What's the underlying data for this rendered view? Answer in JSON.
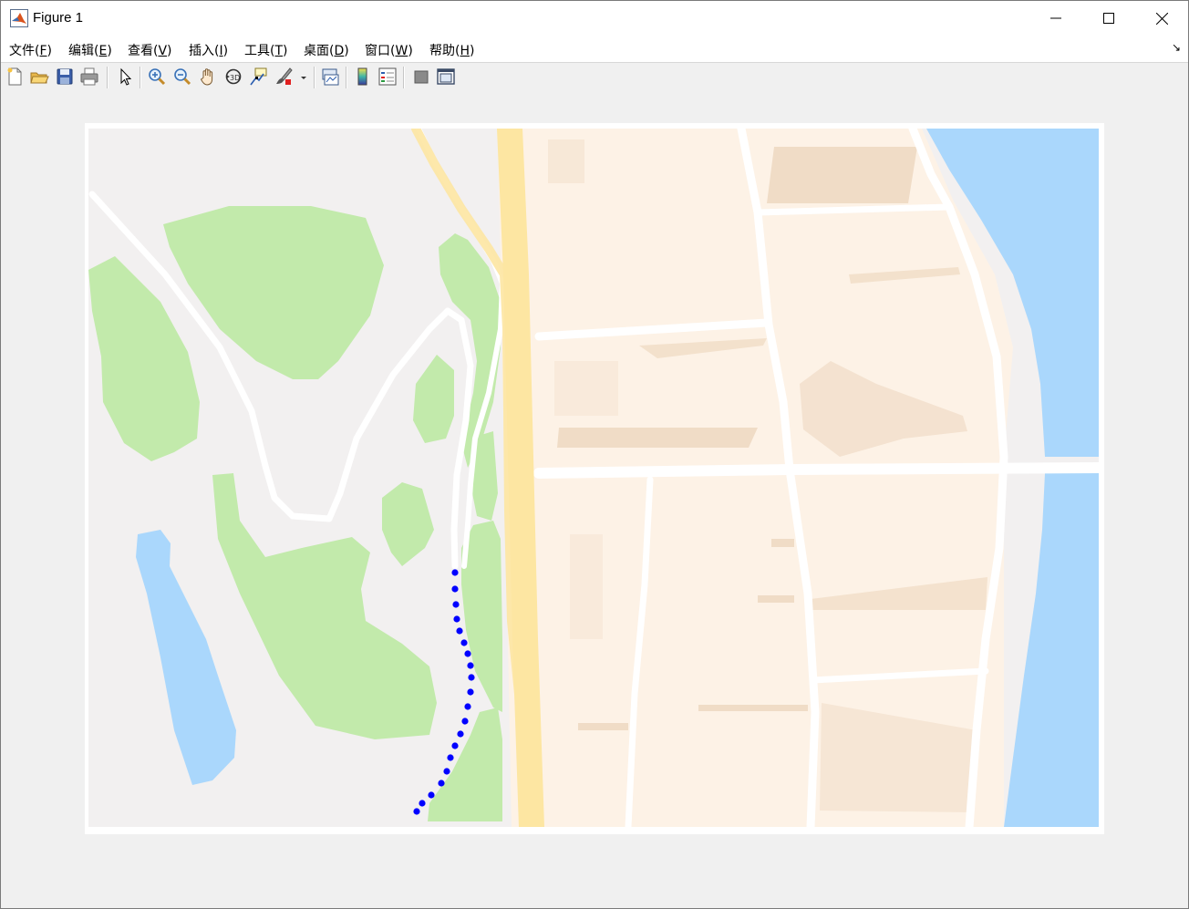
{
  "window": {
    "title": "Figure 1",
    "controls": {
      "minimize": "minimize-icon",
      "maximize": "maximize-icon",
      "close": "close-icon"
    }
  },
  "menubar": {
    "items": [
      {
        "label": "文件(",
        "key": "F",
        "end": ")"
      },
      {
        "label": "编辑(",
        "key": "E",
        "end": ")"
      },
      {
        "label": "查看(",
        "key": "V",
        "end": ")"
      },
      {
        "label": "插入(",
        "key": "I",
        "end": ")"
      },
      {
        "label": "工具(",
        "key": "T",
        "end": ")"
      },
      {
        "label": "桌面(",
        "key": "D",
        "end": ")"
      },
      {
        "label": "窗口(",
        "key": "W",
        "end": ")"
      },
      {
        "label": "帮助(",
        "key": "H",
        "end": ")"
      }
    ]
  },
  "toolbar": {
    "buttons": [
      "new-figure-icon",
      "open-file-icon",
      "save-icon",
      "print-icon",
      "edit-plot-arrow-icon",
      "zoom-in-icon",
      "zoom-out-icon",
      "pan-hand-icon",
      "rotate-3d-icon",
      "data-cursor-icon",
      "brush-icon",
      "brush-dropdown-icon",
      "link-plot-icon",
      "insert-colorbar-icon",
      "insert-legend-icon",
      "hide-plot-tools-icon",
      "show-plot-tools-icon"
    ]
  },
  "map": {
    "colors": {
      "land": "#f2f0f0",
      "park": "#c2eaab",
      "water": "#aad7fc",
      "urban": "#fdf2e6",
      "building": "#f0dcc6",
      "highway": "#fde6a2",
      "road": "#ffffff",
      "track_marker": "#0000ff"
    }
  }
}
